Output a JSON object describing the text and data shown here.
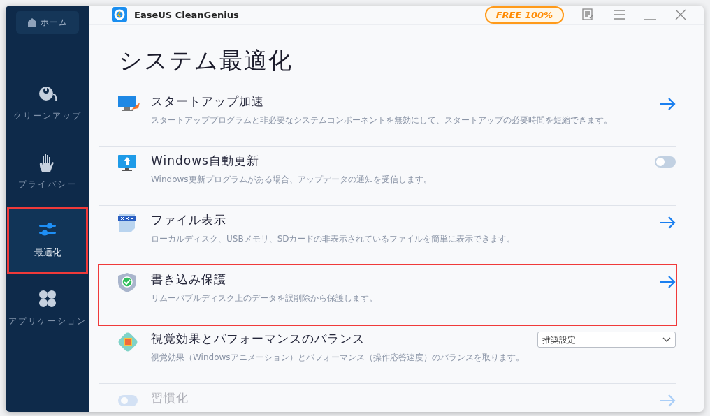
{
  "window": {
    "title": "EaseUS CleanGenius",
    "badge": "FREE 100%"
  },
  "sidebar": {
    "home": "ホーム",
    "items": [
      {
        "label": "クリーンアップ",
        "selected": false,
        "highlighted": false
      },
      {
        "label": "プライバシー",
        "selected": false,
        "highlighted": false
      },
      {
        "label": "最適化",
        "selected": true,
        "highlighted": true
      },
      {
        "label": "アプリケーション",
        "selected": false,
        "highlighted": false
      }
    ]
  },
  "heading": "システム最適化",
  "rows": [
    {
      "kind": "arrow",
      "title": "スタートアップ加速",
      "description": "スタートアッププログラムと非必要なシステムコンポーネントを無効にして、スタートアップの必要時間を短縮できます。",
      "highlighted": false,
      "faded": false
    },
    {
      "kind": "toggle",
      "title": "Windows自動更新",
      "description": "Windows更新プログラムがある場合、アップデータの通知を受信します。",
      "on": false,
      "highlighted": false,
      "faded": false
    },
    {
      "kind": "arrow",
      "title": "ファイル表示",
      "description": "ローカルディスク、USBメモリ、SDカードの非表示されているファイルを簡単に表示できます。",
      "highlighted": false,
      "faded": false
    },
    {
      "kind": "arrow",
      "title": "書き込み保護",
      "description": "リムーバブルディスク上のデータを誤削除から保護します。",
      "highlighted": true,
      "faded": false
    },
    {
      "kind": "select",
      "title": "視覚効果とパフォーマンスのバランス",
      "description": "視覚効果（Windowsアニメーション）とパフォーマンス（操作応答速度）のバランスを取ります。",
      "value": "推奨設定",
      "highlighted": false,
      "faded": false
    },
    {
      "kind": "arrow",
      "title": "習慣化",
      "highlighted": false,
      "faded": true
    }
  ]
}
